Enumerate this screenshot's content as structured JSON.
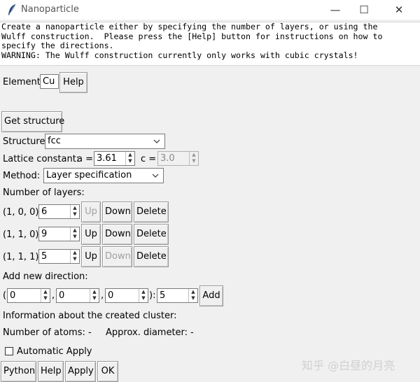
{
  "window": {
    "title": "Nanoparticle",
    "minimize": "—",
    "maximize": "☐",
    "close": "✕"
  },
  "intro": {
    "lines": [
      "Create a nanoparticle either by specifying the number of layers, or using the",
      "Wulff construction.  Please press the [Help] button for instructions on how to",
      "specify the directions.",
      "WARNING: The Wulff construction currently only works with cubic crystals!"
    ]
  },
  "element": {
    "label": "Element:",
    "value": "Cu",
    "help": "Help"
  },
  "get_structure": "Get structure",
  "structure": {
    "label": "Structure:",
    "value": "fcc"
  },
  "lattice": {
    "label": "Lattice constant:",
    "a_label": "a =",
    "a_value": "3.61",
    "c_label": "c =",
    "c_value": "3.0"
  },
  "method": {
    "label": "Method:",
    "value": "Layer specification"
  },
  "layers": {
    "label": "Number of layers:",
    "rows": [
      {
        "direction": "(1, 0, 0):",
        "value": "6",
        "up": "Up",
        "down": "Down",
        "delete": "Delete",
        "up_enabled": false,
        "down_enabled": true
      },
      {
        "direction": "(1, 1, 0):",
        "value": "9",
        "up": "Up",
        "down": "Down",
        "delete": "Delete",
        "up_enabled": true,
        "down_enabled": true
      },
      {
        "direction": "(1, 1, 1):",
        "value": "5",
        "up": "Up",
        "down": "Down",
        "delete": "Delete",
        "up_enabled": true,
        "down_enabled": false
      }
    ]
  },
  "new_direction": {
    "label": "Add new direction:",
    "open_paren": "(",
    "sep": ",",
    "close": "):",
    "h": "0",
    "k": "0",
    "l": "0",
    "layers": "5",
    "add": "Add"
  },
  "info": {
    "label": "Information about the created cluster:",
    "atoms_label": "Number of atoms:",
    "atoms_value": "-",
    "diameter_label": "Approx. diameter:",
    "diameter_value": "-"
  },
  "auto_apply": {
    "label": "Automatic Apply",
    "checked": false
  },
  "bottom_buttons": {
    "python": "Python",
    "help": "Help",
    "apply": "Apply",
    "ok": "OK"
  },
  "watermark": "知乎 @白昼的月亮"
}
